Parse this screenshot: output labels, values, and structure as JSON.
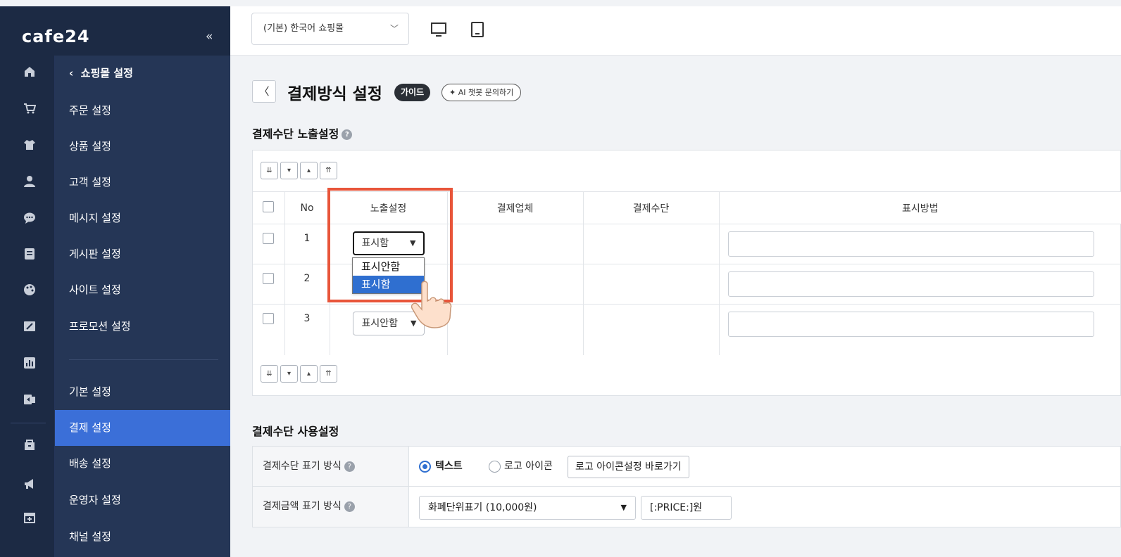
{
  "brand": {
    "logo": "cafe24",
    "collapse_icon": "«"
  },
  "sidebar": {
    "items": [
      {
        "label": "쇼핑몰 설정",
        "prefix": "‹"
      },
      {
        "label": "주문 설정"
      },
      {
        "label": "상품 설정"
      },
      {
        "label": "고객 설정"
      },
      {
        "label": "메시지 설정"
      },
      {
        "label": "게시판 설정"
      },
      {
        "label": "사이트 설정"
      },
      {
        "label": "프로모션 설정"
      },
      {
        "label": "기본 설정"
      },
      {
        "label": "결제 설정",
        "active": true
      },
      {
        "label": "배송 설정"
      },
      {
        "label": "운영자 설정"
      },
      {
        "label": "채널 설정"
      }
    ],
    "rail_icons": [
      "home-icon",
      "cart-icon",
      "shirt-icon",
      "user-icon",
      "chat-icon",
      "board-icon",
      "palette-icon",
      "promo-icon",
      "chart-icon",
      "exchange-icon",
      "store-icon",
      "megaphone-icon",
      "add-app-icon"
    ]
  },
  "topbar": {
    "mall_select": "(기본) 한국어 쇼핑몰",
    "device_icons": [
      "desktop-icon",
      "mobile-icon"
    ]
  },
  "page": {
    "title": "결제방식 설정",
    "guide_badge": "가이드",
    "ai_button": "AI 챗봇 문의하기",
    "ai_icon": "sparkle-icon"
  },
  "exposure": {
    "section_title": "결제수단 노출설정",
    "columns": [
      "No",
      "노출설정",
      "결제업체",
      "결제수단",
      "표시방법"
    ],
    "rows": [
      {
        "no": "1",
        "exposure": "표시함"
      },
      {
        "no": "2",
        "exposure": "표시함"
      },
      {
        "no": "3",
        "exposure": "표시안함"
      }
    ],
    "dropdown_options": [
      "표시안함",
      "표시함"
    ],
    "dropdown_highlighted": "표시함"
  },
  "usage": {
    "section_title": "결제수단 사용설정",
    "display_mode": {
      "label": "결제수단 표기 방식",
      "option_text": "텍스트",
      "option_logo": "로고 아이콘",
      "logo_button": "로고 아이콘설정 바로가기"
    },
    "amount_mode": {
      "label": "결제금액 표기 방식",
      "select_value": "화폐단위표기 (10,000원)",
      "format_value": "[:PRICE:]원"
    }
  },
  "colors": {
    "sidebar_bg": "#1c2a44",
    "menu_bg": "#253656",
    "active": "#3b6fd8",
    "highlight_border": "#e8553a",
    "radio_on": "#2f6fd0"
  }
}
